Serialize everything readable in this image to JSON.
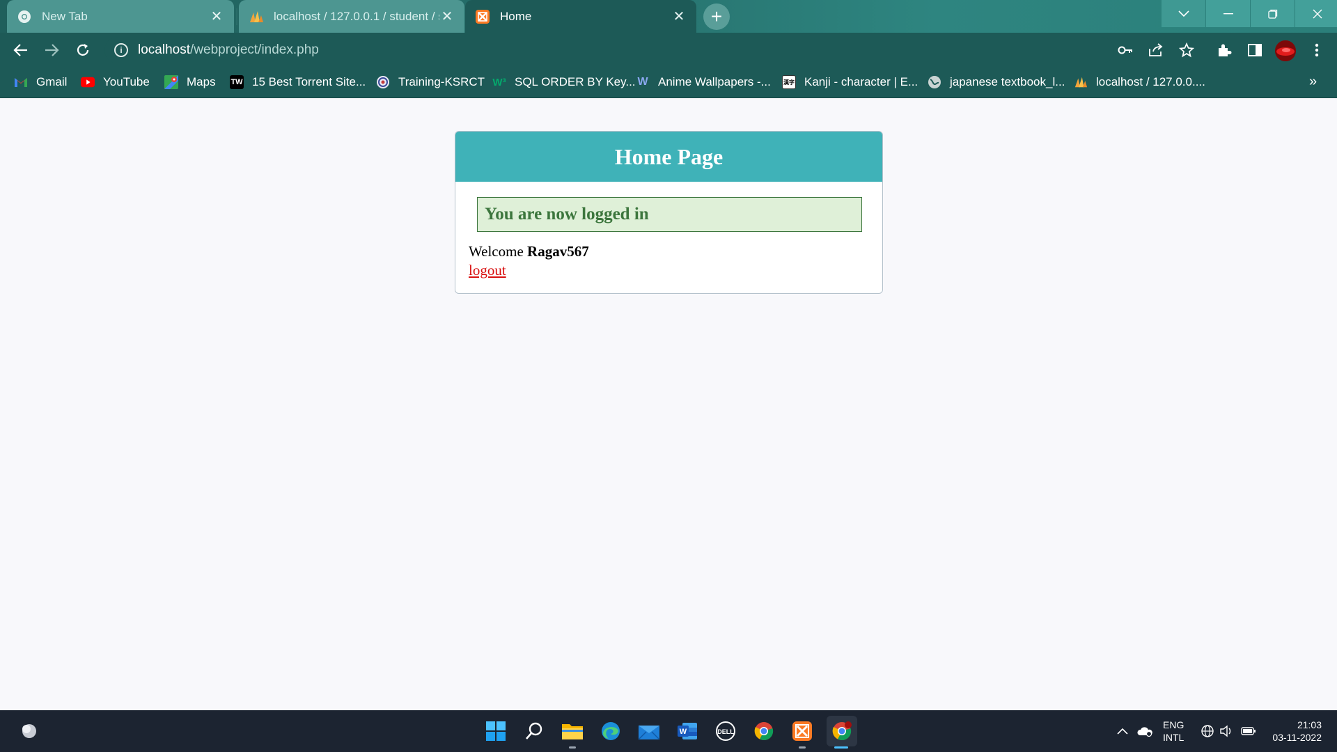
{
  "browser": {
    "tabs": [
      {
        "label": "New Tab",
        "icon": "chrome-icon"
      },
      {
        "label": "localhost / 127.0.0.1 / student / s",
        "icon": "phpmyadmin-icon"
      },
      {
        "label": "Home",
        "icon": "xampp-icon"
      }
    ],
    "active_tab": 2,
    "url_host": "localhost",
    "url_path": "/webproject/index.php",
    "bookmarks": [
      {
        "label": "Gmail",
        "icon": "gmail-icon"
      },
      {
        "label": "YouTube",
        "icon": "youtube-icon"
      },
      {
        "label": "Maps",
        "icon": "maps-icon"
      },
      {
        "label": "15 Best Torrent Site...",
        "icon": "tw-icon"
      },
      {
        "label": "Training-KSRCT",
        "icon": "ksrct-icon"
      },
      {
        "label": "SQL ORDER BY Key...",
        "icon": "w3schools-icon"
      },
      {
        "label": "Anime Wallpapers -...",
        "icon": "wallpapers-icon"
      },
      {
        "label": "Kanji - character | E...",
        "icon": "kanji-icon"
      },
      {
        "label": "japanese textbook_l...",
        "icon": "globe-icon"
      },
      {
        "label": "localhost / 127.0.0....",
        "icon": "phpmyadmin-icon"
      }
    ],
    "bookmarks_more": "»"
  },
  "page": {
    "header_title": "Home Page",
    "success_message": "You are now logged in",
    "welcome_prefix": "Welcome",
    "username": "Ragav567",
    "logout_label": "logout"
  },
  "taskbar": {
    "language_line1": "ENG",
    "language_line2": "INTL",
    "time": "21:03",
    "date": "03-11-2022"
  },
  "colors": {
    "header_bg": "#3fb2b8",
    "success_bg": "#dff0d8",
    "success_text": "#3c763d",
    "logout_link": "#d91010",
    "browser_frame": "#1d5a57"
  }
}
